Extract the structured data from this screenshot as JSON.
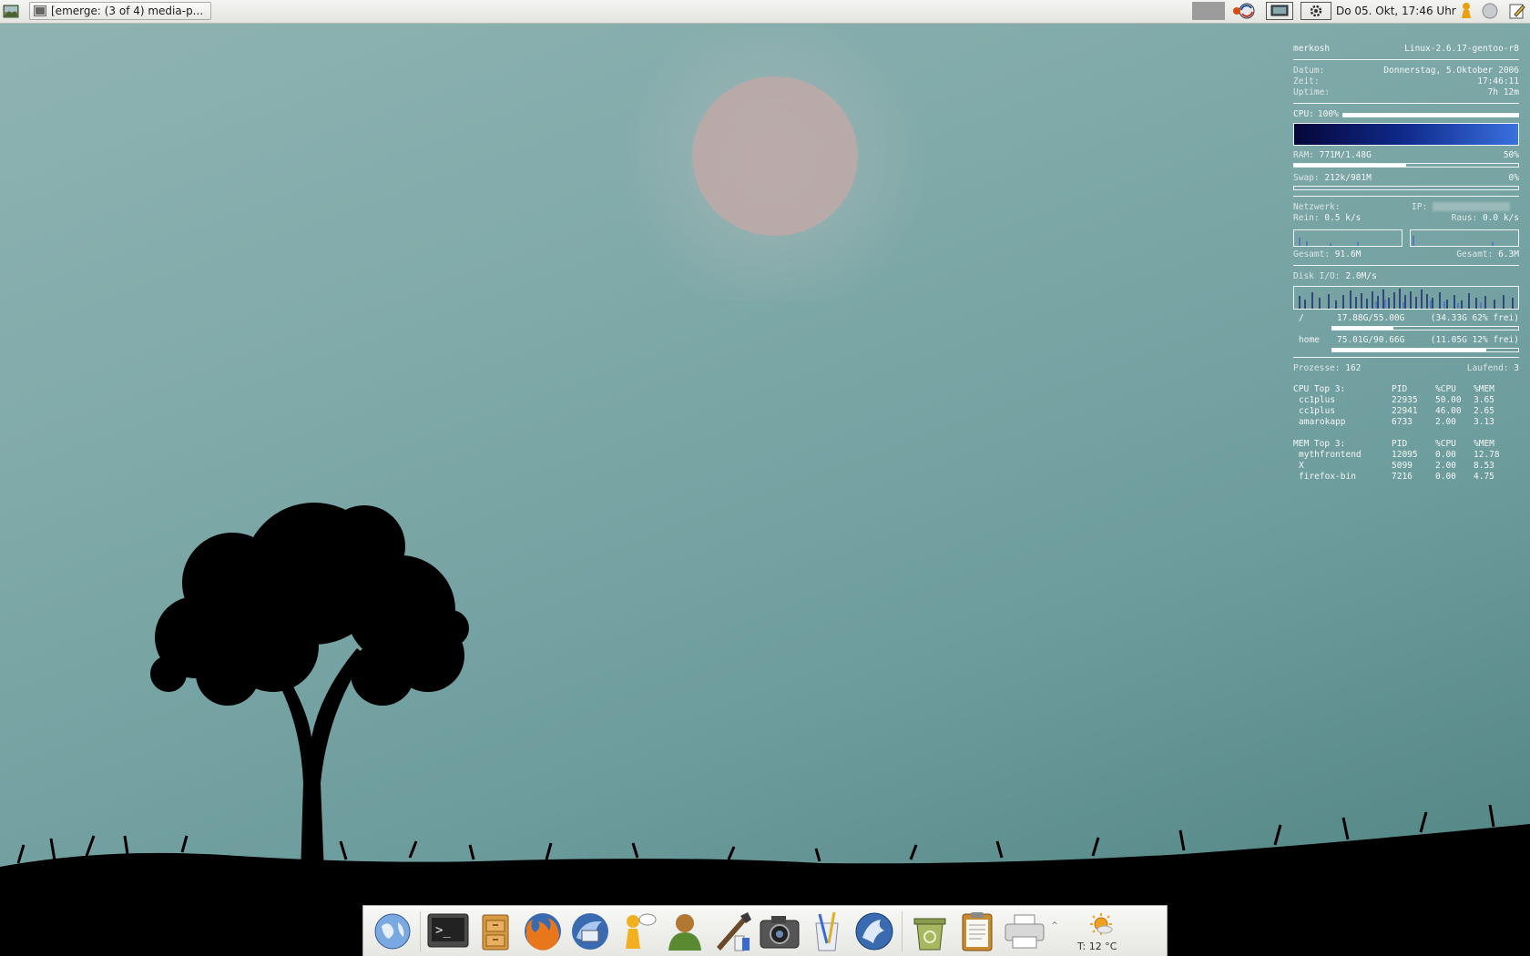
{
  "taskbar": {
    "task_title": "[emerge: (3 of 4) media-p...",
    "clock": "Do 05. Okt, 17:46 Uhr"
  },
  "conky": {
    "user": "merkosh",
    "kernel": "Linux-2.6.17-gentoo-r8",
    "datum_label": "Datum:",
    "datum_value": "Donnerstag, 5.Oktober 2006",
    "zeit_label": "Zeit:",
    "zeit_value": "17:46:11",
    "uptime_label": "Uptime:",
    "uptime_value": "7h 12m",
    "cpu_label": "CPU:",
    "cpu_value": "100%",
    "cpu_fraction": 1.0,
    "ram_label": "RAM:",
    "ram_value": "771M/1.48G",
    "ram_percent": "50%",
    "ram_fraction": 0.5,
    "swap_label": "Swap:",
    "swap_value": "212k/981M",
    "swap_percent": "0%",
    "swap_fraction": 0.0,
    "net_label": "Netzwerk:",
    "ip_label": "IP:",
    "rein_label": "Rein:",
    "rein_value": "0.5 k/s",
    "raus_label": "Raus:",
    "raus_value": "0.0 k/s",
    "gesamt_label": "Gesamt:",
    "gesamt_in": "91.6M",
    "gesamt_out": "6.3M",
    "disk_label": "Disk I/O:",
    "disk_value": "2.0M/s",
    "filesystems": [
      {
        "name": "/",
        "usage": "17.88G/55.00G",
        "free": "(34.33G 62% frei)",
        "used_fraction": 0.33
      },
      {
        "name": "home",
        "usage": "75.01G/90.66G",
        "free": "(11.05G 12% frei)",
        "used_fraction": 0.83
      }
    ],
    "prozesse_label": "Prozesse:",
    "prozesse_value": "162",
    "laufend_label": "Laufend:",
    "laufend_value": "3",
    "cpu_top": {
      "title": "CPU Top 3:",
      "headers": [
        "PID",
        "%CPU",
        "%MEM"
      ],
      "rows": [
        {
          "name": "cc1plus",
          "pid": "22935",
          "cpu": "50.00",
          "mem": "3.65"
        },
        {
          "name": "cc1plus",
          "pid": "22941",
          "cpu": "46.00",
          "mem": "2.65"
        },
        {
          "name": "amarokapp",
          "pid": "6733",
          "cpu": "2.00",
          "mem": "3.13"
        }
      ]
    },
    "mem_top": {
      "title": "MEM Top 3:",
      "headers": [
        "PID",
        "%CPU",
        "%MEM"
      ],
      "rows": [
        {
          "name": "mythfrontend",
          "pid": "12095",
          "cpu": "0.00",
          "mem": "12.78"
        },
        {
          "name": "X",
          "pid": "5099",
          "cpu": "2.00",
          "mem": "8.53"
        },
        {
          "name": "firefox-bin",
          "pid": "7216",
          "cpu": "0.00",
          "mem": "4.75"
        }
      ]
    }
  },
  "dock": {
    "icons": [
      "globe-icon",
      "terminal-icon",
      "file-cabinet-icon",
      "firefox-icon",
      "thunderbird-icon",
      "im-chat-icon",
      "user-icon",
      "paint-icon",
      "camera-icon",
      "text-editor-icon",
      "amarok-icon",
      "trash-icon",
      "clipboard-icon",
      "printer-icon"
    ],
    "weather_text": "T: 12 °C"
  },
  "colors": {
    "panel": "#e8e8e4",
    "desktop": "#7fa9a9",
    "conky_text": "#f4f6f6"
  }
}
